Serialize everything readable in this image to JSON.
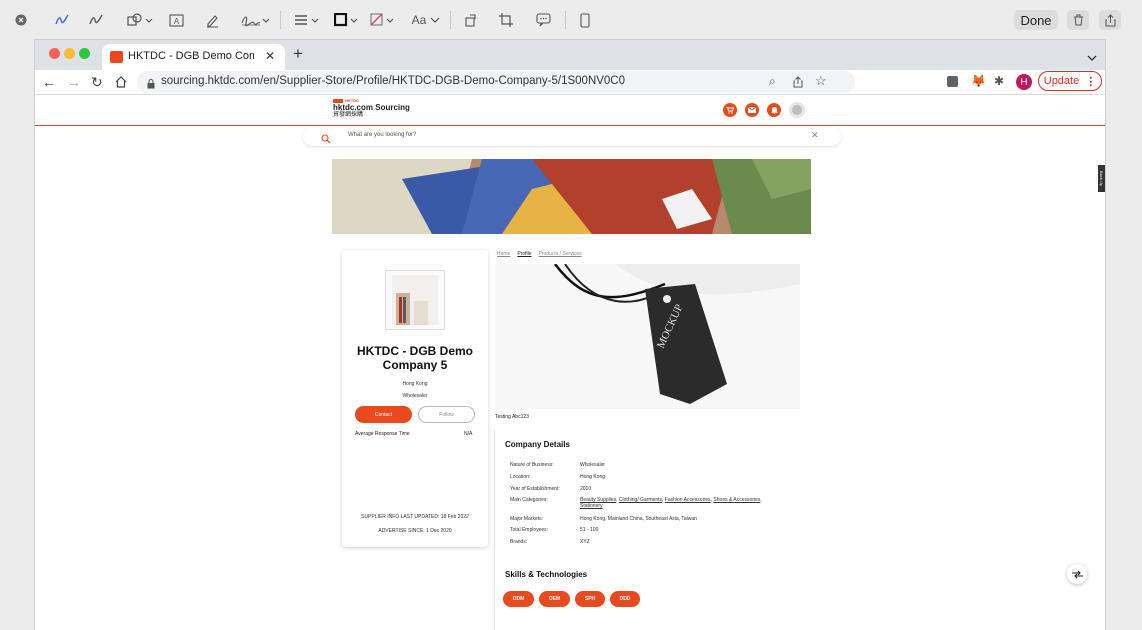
{
  "markup_toolbar": {
    "done_label": "Done",
    "font_label": "Aa"
  },
  "browser": {
    "tab_title": "HKTDC - DGB Demo Company",
    "url": "sourcing.hktdc.com/en/Supplier-Store/Profile/HKTDC-DGB-Demo-Company-5/1S00NV0C0",
    "update_label": "Update",
    "profile_initial": "H"
  },
  "site": {
    "logo_small": "HKTDC",
    "logo_title": "hktdc.com Sourcing",
    "logo_chinese": "貿發網採購",
    "search_placeholder": "What are you looking for?",
    "side_tab": "Back Up"
  },
  "breadcrumb": {
    "items": [
      "Home",
      "Profile",
      "Products / Services"
    ]
  },
  "company_card": {
    "name": "HKTDC - DGB Demo Company 5",
    "location": "Hong Kong",
    "type": "Wholesaler",
    "contact_label": "Contact",
    "follow_label": "Follow",
    "response_label": "Average Response Time",
    "response_value": "N/A",
    "updated": "SUPPLIER INFO LAST UPDATED: 18 Feb 2022",
    "advertise": "ADVERTISE SINCE: 1 Dec 2020"
  },
  "hero_caption": "Testing Abc123",
  "company_details": {
    "heading": "Company Details",
    "rows": [
      {
        "label": "Nature of Business:",
        "value": "Wholesaler"
      },
      {
        "label": "Location:",
        "value": "Hong Kong"
      },
      {
        "label": "Year of Establishment:",
        "value": "2010"
      },
      {
        "label": "Main Categories:",
        "links": [
          "Beauty Supplies",
          "Clothing/ Garments",
          "Fashion Accessories",
          "Shoes & Accessories",
          "Stationery"
        ]
      },
      {
        "label": "Major Markets:",
        "value": "Hong Kong, Mainland China, Southeast Asia, Taiwan"
      },
      {
        "label": "Total Employees:",
        "value": "51 - 100"
      },
      {
        "label": "Brands:",
        "value": "XYZ"
      }
    ]
  },
  "skills": {
    "heading": "Skills & Technologies",
    "items": [
      "ODM",
      "OEM",
      "SPH",
      "DDD"
    ]
  },
  "colors": {
    "brand": "#e8491d",
    "update": "#d93025"
  }
}
